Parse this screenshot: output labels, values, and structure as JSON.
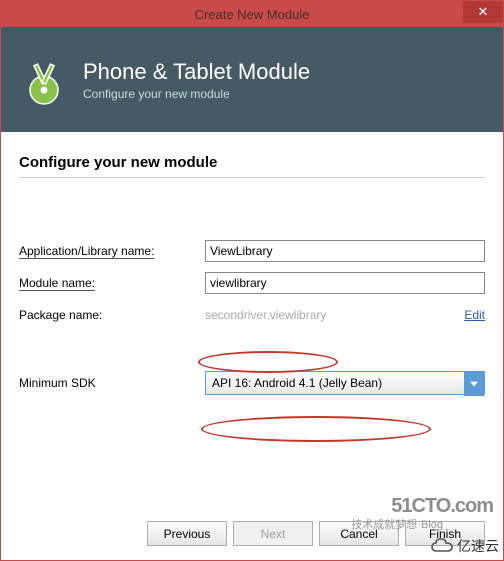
{
  "titlebar": {
    "title": "Create New Module",
    "close_glyph": "✕"
  },
  "hero": {
    "title": "Phone & Tablet Module",
    "subtitle": "Configure your new module"
  },
  "section_title": "Configure your new module",
  "fields": {
    "app_name": {
      "label": "Application/Library name:",
      "value": "ViewLibrary"
    },
    "module_name": {
      "label": "Module name:",
      "value": "viewlibrary"
    },
    "package_name": {
      "label": "Package name:",
      "value": "secondriver.viewlibrary",
      "edit": "Edit"
    },
    "min_sdk": {
      "label": "Minimum SDK",
      "value": "API 16: Android 4.1 (Jelly Bean)"
    }
  },
  "buttons": {
    "previous": "Previous",
    "next": "Next",
    "cancel": "Cancel",
    "finish": "Finish"
  },
  "watermarks": {
    "w1": "51CTO.com",
    "w2": "亿速云",
    "w3": "技术成就梦想·Blog"
  }
}
